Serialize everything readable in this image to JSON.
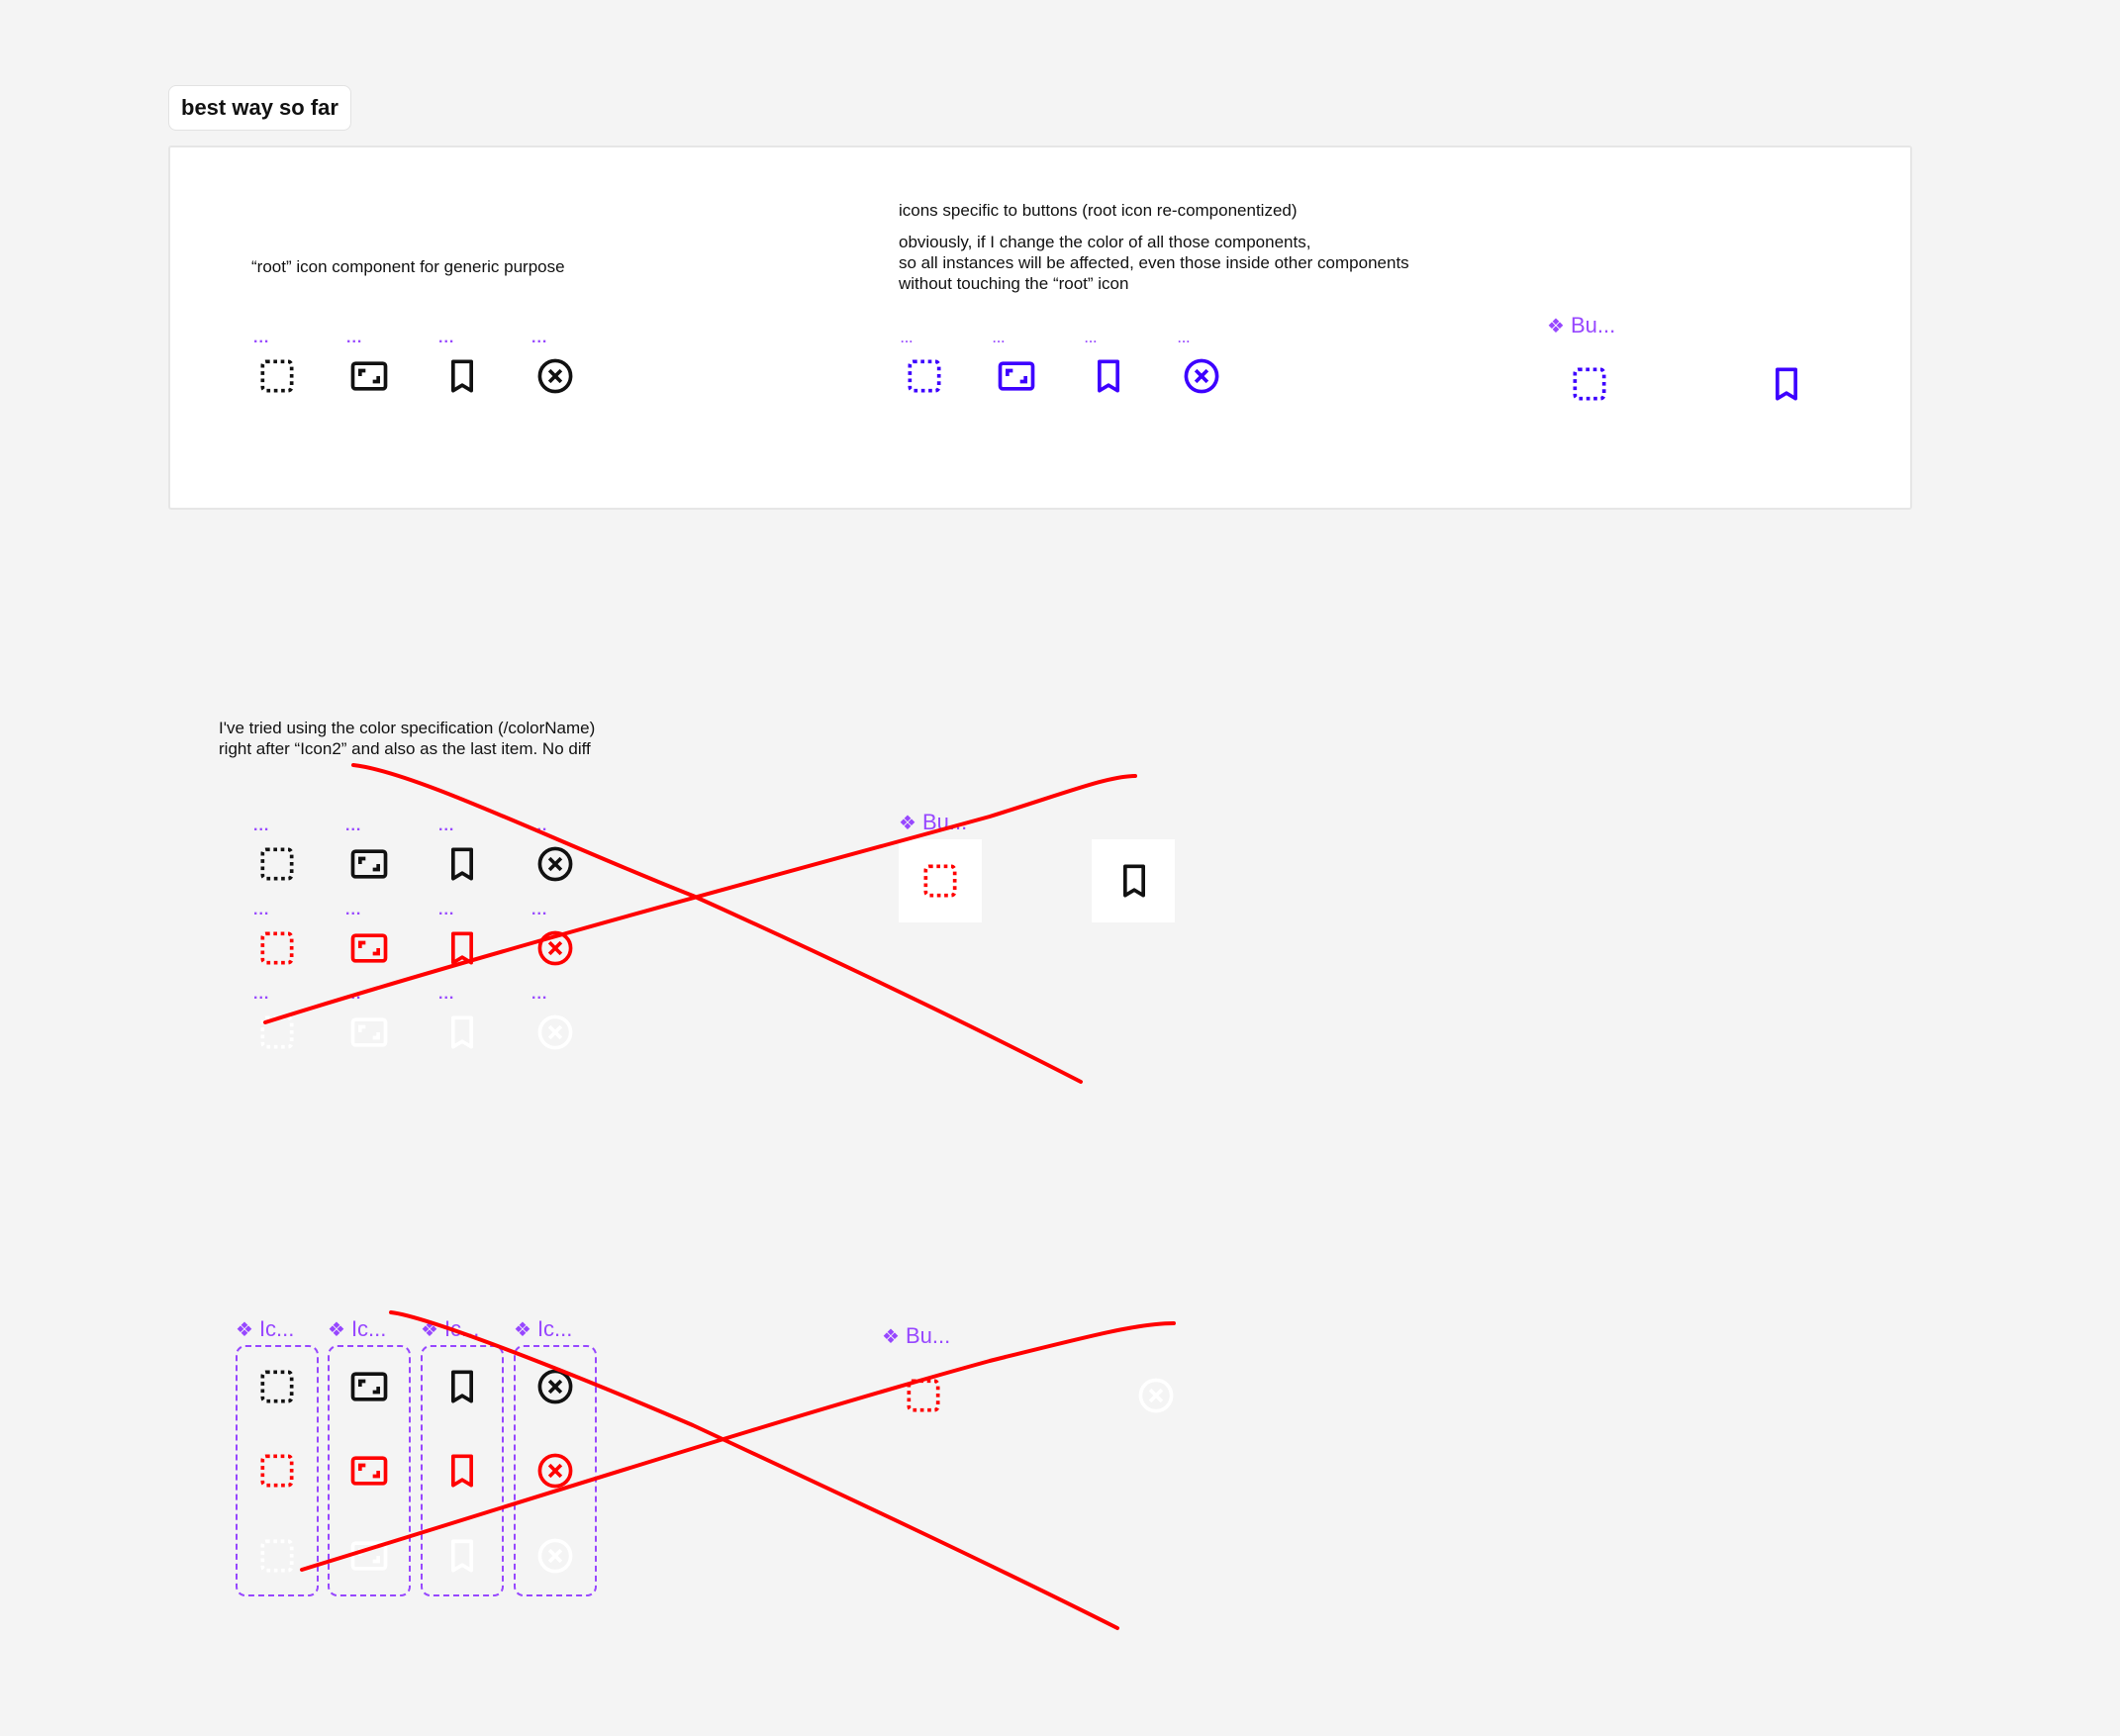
{
  "canvas": {
    "background": "#f4f4f4",
    "accent_component": "#9747ff",
    "colors": {
      "black": "#111111",
      "red": "#ff0000",
      "white": "#ffffff",
      "blue": "#3d00ff"
    }
  },
  "section_tag": {
    "label": "best way so far"
  },
  "best_way_card": {
    "root_note": "“root” icon component for generic purpose",
    "root_icons": [
      {
        "icon": "dotted-square-icon",
        "overflow": "..."
      },
      {
        "icon": "fullscreen-frame-icon",
        "overflow": "..."
      },
      {
        "icon": "bookmark-icon",
        "overflow": "..."
      },
      {
        "icon": "close-circle-icon",
        "overflow": "..."
      }
    ],
    "button_icons_title": "icons specific to buttons (root icon re-componentized)",
    "button_icons_note": "obviously, if I change the color of all those components,\nso all instances will be affected, even those inside other components\nwithout touching the “root” icon",
    "button_icons": [
      {
        "icon": "dotted-square-icon",
        "overflow": "..."
      },
      {
        "icon": "fullscreen-frame-icon",
        "overflow": "..."
      },
      {
        "icon": "bookmark-icon",
        "overflow": "..."
      },
      {
        "icon": "close-circle-icon",
        "overflow": "..."
      }
    ],
    "button_component": {
      "label": "Bu...",
      "glyph": "❖",
      "icons": [
        "dotted-square-icon",
        "bookmark-icon"
      ]
    }
  },
  "attempt_two": {
    "note": "I've tried using the color specification (/colorName)\nright after “Icon2” and also as the last item. No diff",
    "overflow": "...",
    "rows": [
      {
        "color": "black",
        "icons": [
          "dotted-square-icon",
          "fullscreen-frame-icon",
          "bookmark-icon",
          "close-circle-icon"
        ]
      },
      {
        "color": "red",
        "icons": [
          "dotted-square-icon",
          "fullscreen-frame-icon",
          "bookmark-icon",
          "close-circle-icon"
        ]
      },
      {
        "color": "white",
        "icons": [
          "dotted-square-icon",
          "fullscreen-frame-icon",
          "bookmark-icon",
          "close-circle-icon"
        ]
      }
    ],
    "button_component": {
      "label": "Bu...",
      "glyph": "❖",
      "icons": [
        {
          "icon": "dotted-square-icon",
          "color": "red"
        },
        {
          "icon": "bookmark-icon",
          "color": "black"
        }
      ]
    },
    "crossed_out": true
  },
  "attempt_three": {
    "variant_sets": [
      {
        "label": "Ic...",
        "glyph": "❖",
        "icon": "dotted-square-icon"
      },
      {
        "label": "Ic...",
        "glyph": "❖",
        "icon": "fullscreen-frame-icon"
      },
      {
        "label": "Ic...",
        "glyph": "❖",
        "icon": "bookmark-icon"
      },
      {
        "label": "Ic...",
        "glyph": "❖",
        "icon": "close-circle-icon"
      }
    ],
    "variant_colors": [
      "black",
      "red",
      "white"
    ],
    "button_component": {
      "label": "Bu...",
      "glyph": "❖",
      "icons": [
        {
          "icon": "dotted-square-icon",
          "color": "red"
        },
        {
          "icon": "close-circle-icon",
          "color": "white"
        }
      ]
    },
    "crossed_out": true
  }
}
